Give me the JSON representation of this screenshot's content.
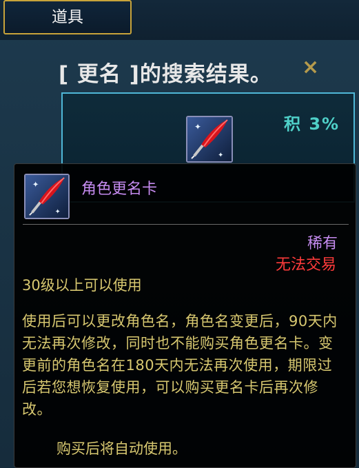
{
  "tab": {
    "label": "道具"
  },
  "search": {
    "prefix": "[ ",
    "keyword": "更名",
    "suffix": " ]的搜索结果。",
    "close_symbol": "×"
  },
  "result_item": {
    "rate_label": "积 3%"
  },
  "tooltip": {
    "name": "角色更名卡",
    "rarity": "稀有",
    "trade_status": "无法交易",
    "level_requirement": "30级以上可以使用",
    "description": "使用后可以更改角色名，角色名变更后，90天内无法再次修改，同时也不能购买角色更名卡。变更前的角色名在180天内无法再次使用，期限过后若您想恢复使用，可以购买更名卡后再次修改。",
    "auto_use_note": "购买后将自动使用。"
  },
  "icons": {
    "item_icon": "red-feather-quill-icon",
    "close_icon": "close-icon"
  },
  "colors": {
    "rarity": "#c58bf0",
    "trade_blocked": "#ff3b3b",
    "description_text": "#d8c870",
    "tab_border": "#c9a43a",
    "card_border": "#4fb8d8"
  }
}
